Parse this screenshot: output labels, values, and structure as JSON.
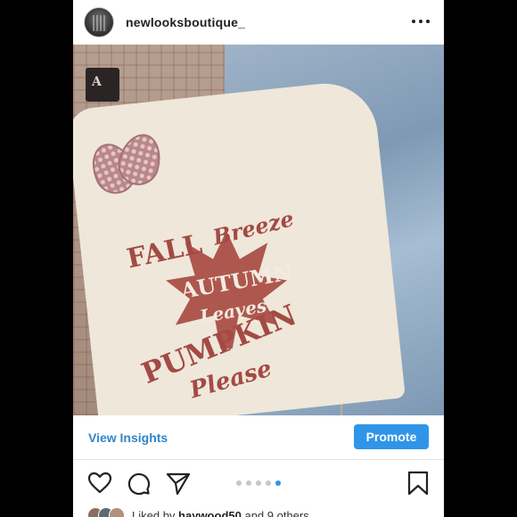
{
  "header": {
    "username": "newlooksboutique_",
    "avatar_icon": "profile-avatar",
    "more_icon": "more-options-icon"
  },
  "photo": {
    "shirt_lines": [
      "FALL",
      "Breeze",
      "AUTUMN",
      "Leaves",
      "PUMPKIN",
      "Please"
    ],
    "tag_text": "A"
  },
  "actions": {
    "insights_label": "View Insights",
    "promote_label": "Promote"
  },
  "toolbar": {
    "icons": [
      "heart-icon",
      "comment-icon",
      "share-icon",
      "bookmark-icon"
    ],
    "carousel_total": 5,
    "carousel_active": 5
  },
  "likes": {
    "prefix": "Liked by",
    "user": "haywood50",
    "suffix": "and 9 others"
  },
  "colors": {
    "accent": "#2f95e8",
    "link": "#2f86c9",
    "shirt_print": "#a34a44"
  }
}
